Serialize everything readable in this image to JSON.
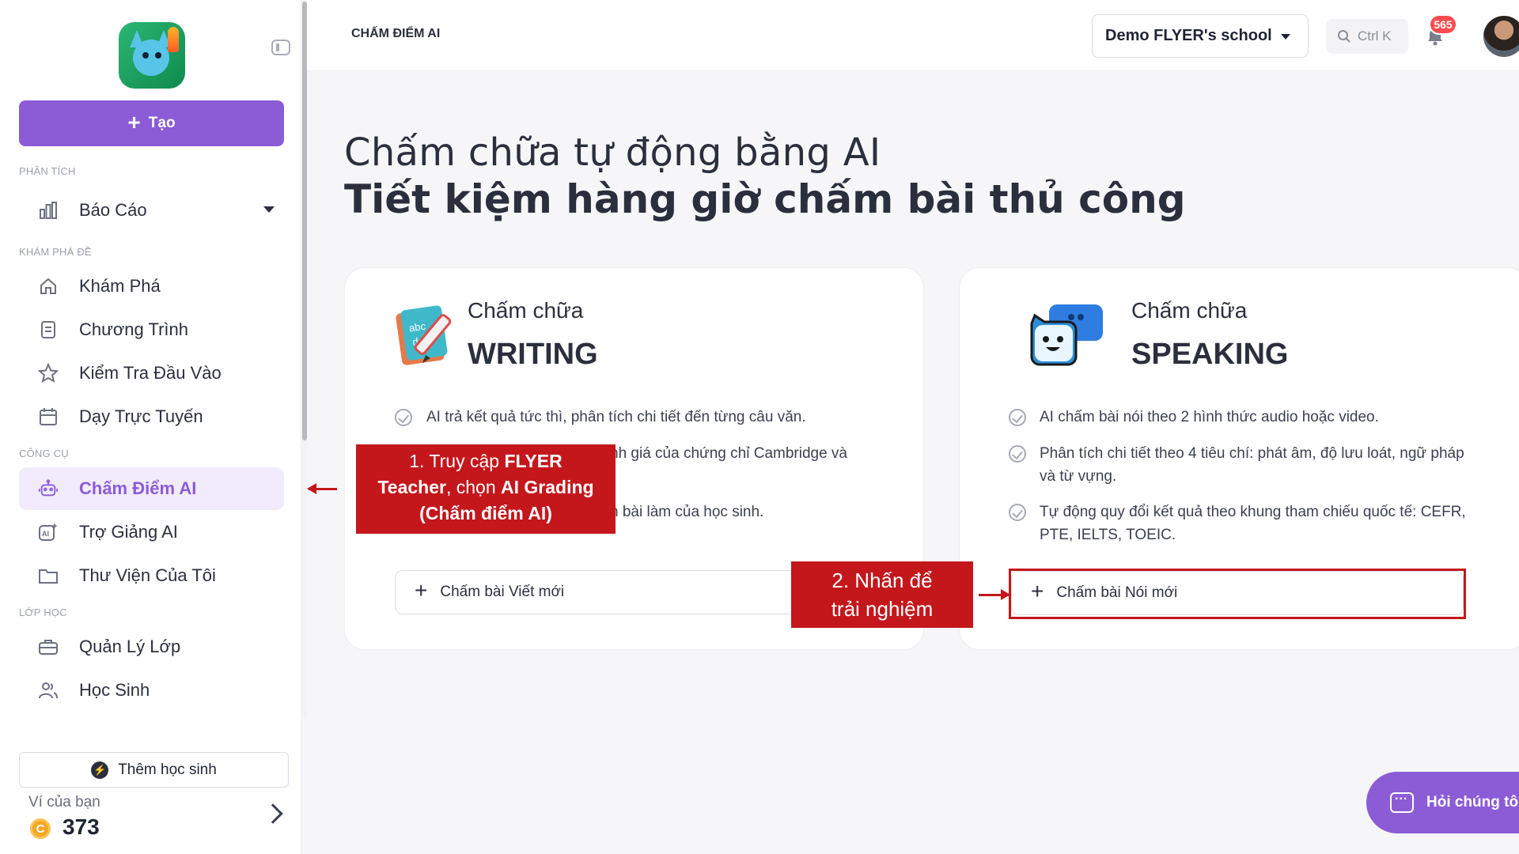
{
  "sidebar": {
    "create_label": "Tạo",
    "sections": {
      "analytics": "PHÂN TÍCH",
      "explore": "KHÁM PHÁ ĐỀ",
      "tools": "CÔNG CỤ",
      "classes": "LỚP HỌC"
    },
    "items": {
      "report": "Báo Cáo",
      "explore": "Khám Phá",
      "program": "Chương Trình",
      "entry_test": "Kiểm Tra Đầu Vào",
      "online_teaching": "Dạy Trực Tuyến",
      "ai_grading": "Chấm Điểm AI",
      "ai_assistant": "Trợ Giảng AI",
      "my_library": "Thư Viện Của Tôi",
      "class_management": "Quản Lý Lớp",
      "students": "Học Sinh"
    },
    "add_student": "Thêm học sinh",
    "wallet_label": "Ví của bạn",
    "wallet_value": "373",
    "coin_letter": "C"
  },
  "header": {
    "breadcrumb": "CHẤM ĐIỂM AI",
    "school": "Demo FLYER's school",
    "search_hint": "Ctrl K",
    "notification_count": "565"
  },
  "main": {
    "headline_1": "Chấm chữa tự động bằng AI",
    "headline_2": "Tiết kiệm hàng giờ chấm bài thủ công",
    "writing": {
      "sub": "Chấm chữa",
      "title": "WRITING",
      "features": [
        "AI trả kết quả tức thì, phân tích chi tiết đến từng câu văn.",
        "nh giá của chứng chỉ Cambridge và",
        "n bài làm của học sinh."
      ],
      "button": "Chấm bài Viết mới"
    },
    "speaking": {
      "sub": "Chấm chữa",
      "title": "SPEAKING",
      "features": [
        "AI chấm bài nói theo 2 hình thức audio hoặc video.",
        "Phân tích chi tiết theo 4 tiêu chí: phát âm, độ lưu loát, ngữ pháp và từ vựng.",
        "Tự động quy đổi kết quả theo khung tham chiếu quốc tế: CEFR, PTE, IELTS, TOEIC."
      ],
      "button": "Chấm bài Nói mới"
    }
  },
  "annotations": {
    "step1_a": "1. Truy cập ",
    "step1_b": "FLYER",
    "step1_c": "Teacher",
    "step1_d": ", chọn ",
    "step1_e": "AI Grading",
    "step1_f": "(Chấm điểm AI)",
    "step2_line1": "2. Nhấn để",
    "step2_line2": "trải nghiệm"
  },
  "ask_button": "Hỏi chúng tôi",
  "colors": {
    "accent": "#8b5cd6",
    "annotation_red": "#c4171c",
    "badge_red": "#ff4d4f"
  }
}
